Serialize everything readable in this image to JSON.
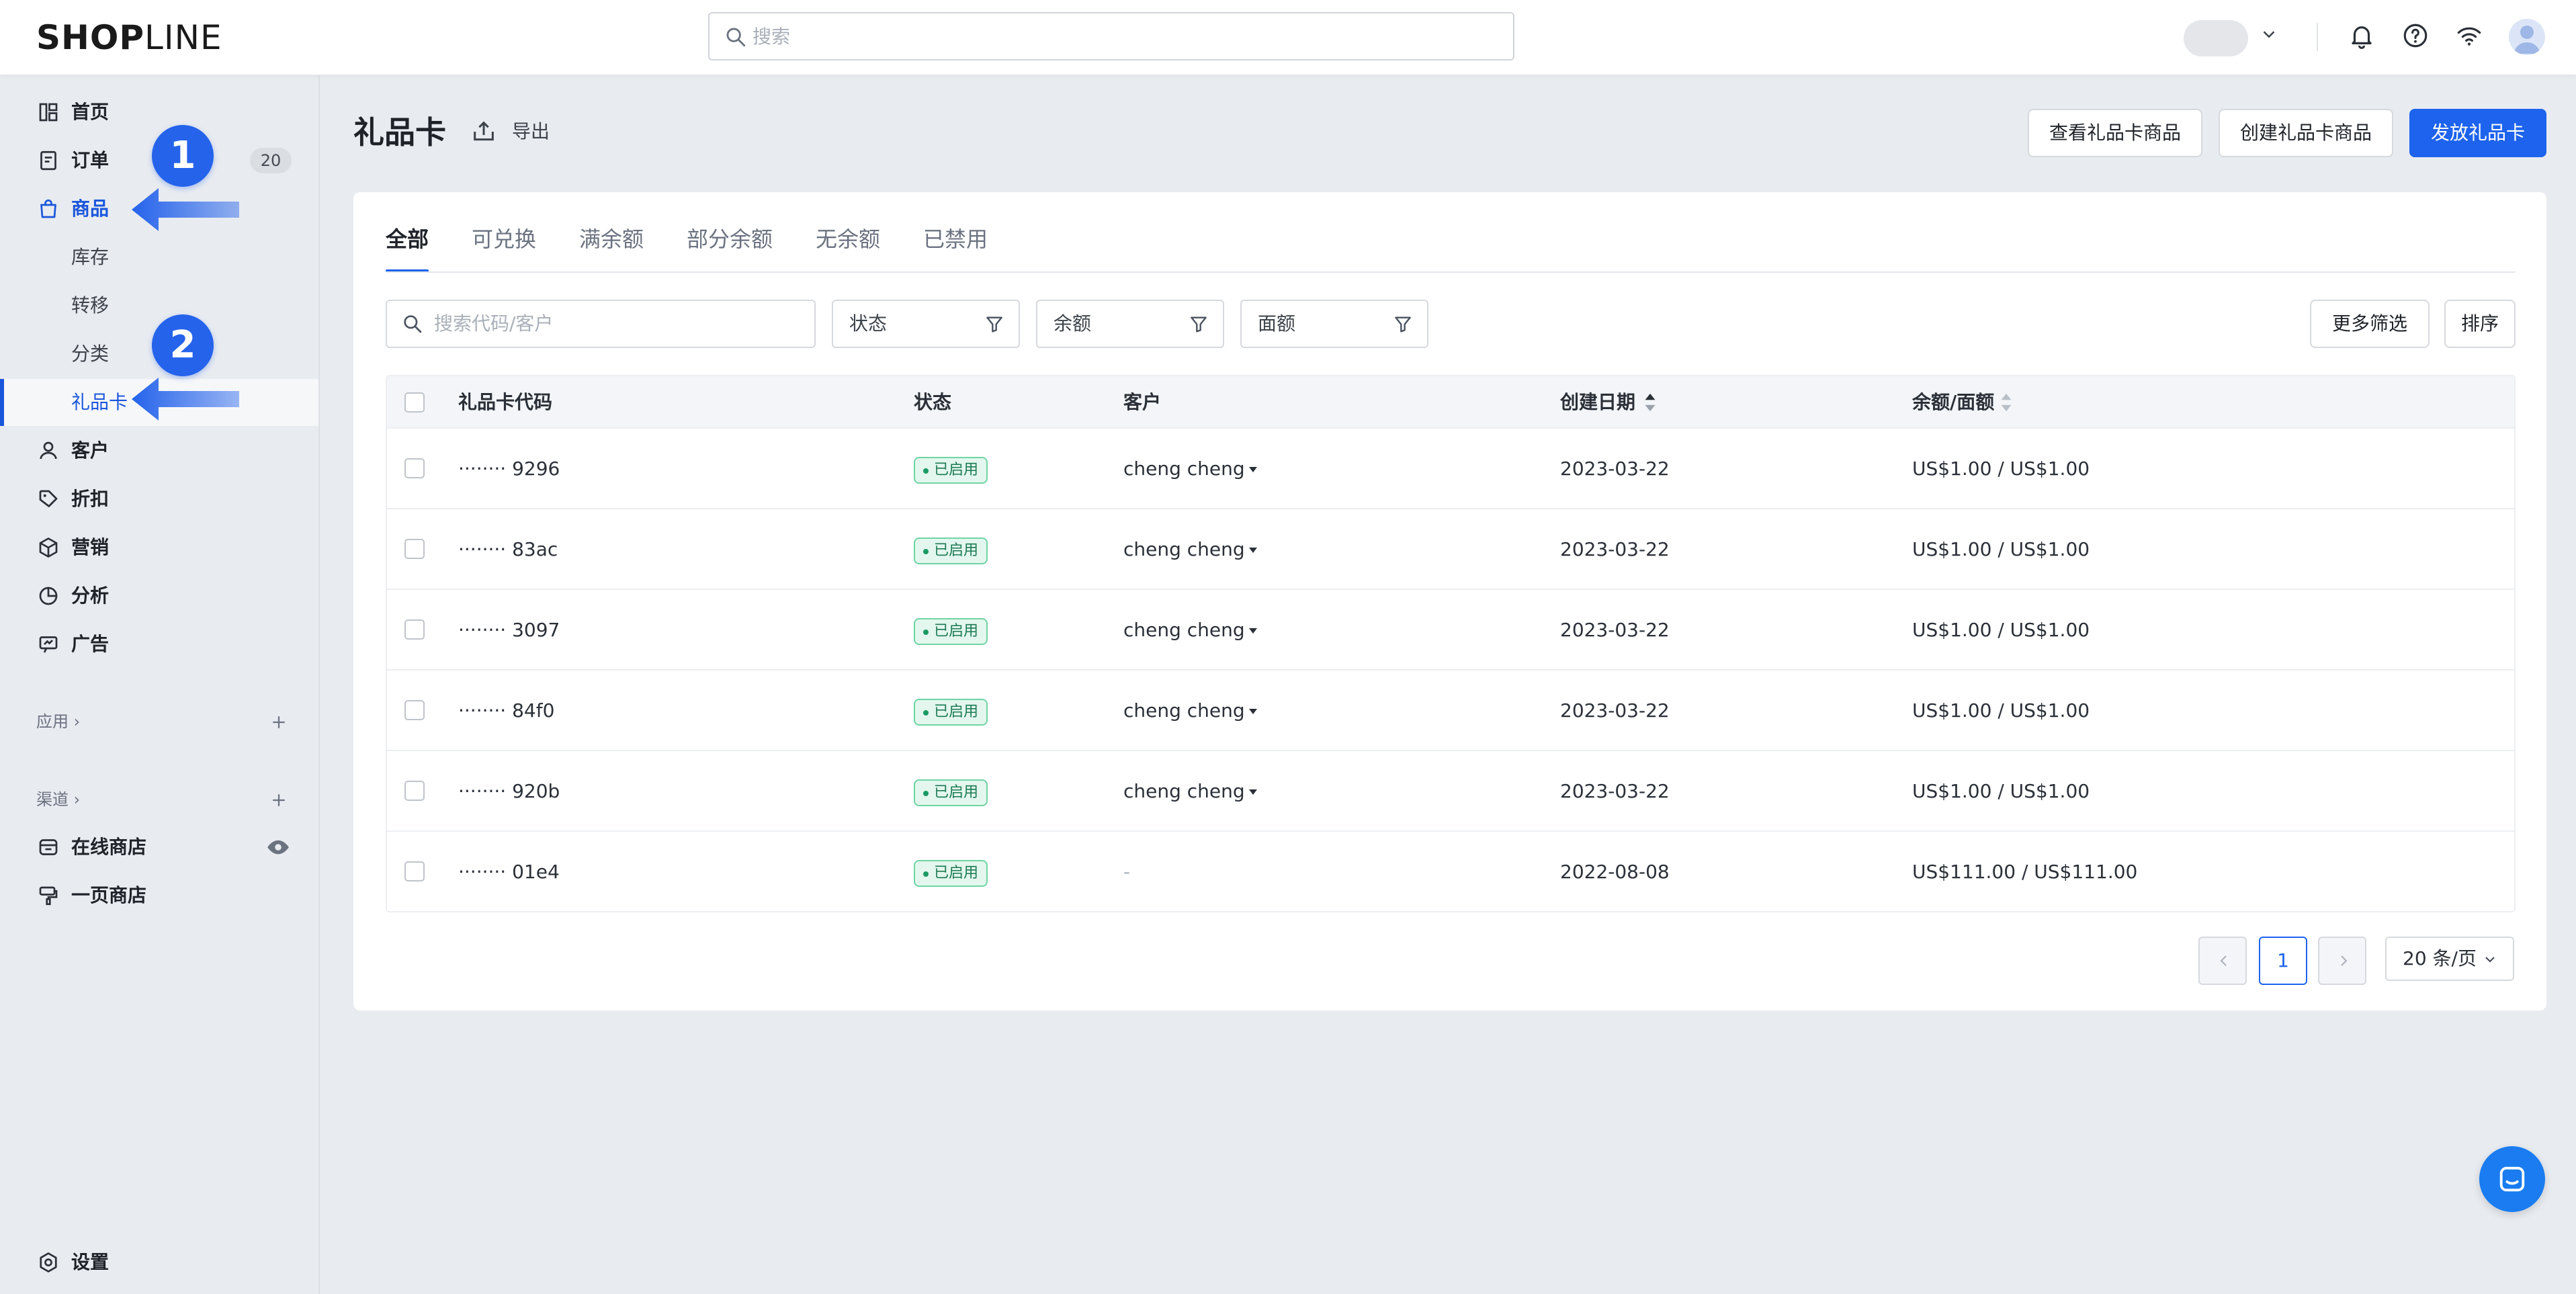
{
  "app": {
    "logo_bold": "SHOP",
    "logo_thin": "LINE"
  },
  "topbar": {
    "search_placeholder": "搜索"
  },
  "sidebar": {
    "items": [
      {
        "label": "首页",
        "icon": "dashboard-icon"
      },
      {
        "label": "订单",
        "icon": "order-icon",
        "badge": "20"
      },
      {
        "label": "商品",
        "icon": "bag-icon",
        "active": true
      },
      {
        "label": "客户",
        "icon": "user-icon"
      },
      {
        "label": "折扣",
        "icon": "tag-icon"
      },
      {
        "label": "营销",
        "icon": "cube-icon"
      },
      {
        "label": "分析",
        "icon": "pie-icon"
      },
      {
        "label": "广告",
        "icon": "ad-icon"
      }
    ],
    "product_sub": [
      "库存",
      "转移",
      "分类",
      "礼品卡"
    ],
    "apps_label": "应用",
    "channels_label": "渠道",
    "channels": [
      "在线商店",
      "一页商店"
    ],
    "settings_label": "设置",
    "callouts": [
      "1",
      "2"
    ]
  },
  "header": {
    "title": "礼品卡",
    "export_label": "导出",
    "buttons": [
      "查看礼品卡商品",
      "创建礼品卡商品",
      "发放礼品卡"
    ]
  },
  "tabs": [
    "全部",
    "可兑换",
    "满余额",
    "部分余额",
    "无余额",
    "已禁用"
  ],
  "filters": {
    "search_placeholder": "搜索代码/客户",
    "status": "状态",
    "balance": "余额",
    "face_value": "面额",
    "more": "更多筛选",
    "sort": "排序"
  },
  "table": {
    "headers": [
      "礼品卡代码",
      "状态",
      "客户",
      "创建日期",
      "余额/面额"
    ],
    "rows": [
      {
        "code": "········ 9296",
        "status": "已启用",
        "customer": "cheng cheng",
        "date": "2023-03-22",
        "balance": "US$1.00 / US$1.00"
      },
      {
        "code": "········ 83ac",
        "status": "已启用",
        "customer": "cheng cheng",
        "date": "2023-03-22",
        "balance": "US$1.00 / US$1.00"
      },
      {
        "code": "········ 3097",
        "status": "已启用",
        "customer": "cheng cheng",
        "date": "2023-03-22",
        "balance": "US$1.00 / US$1.00"
      },
      {
        "code": "········ 84f0",
        "status": "已启用",
        "customer": "cheng cheng",
        "date": "2023-03-22",
        "balance": "US$1.00 / US$1.00"
      },
      {
        "code": "········ 920b",
        "status": "已启用",
        "customer": "cheng cheng",
        "date": "2023-03-22",
        "balance": "US$1.00 / US$1.00"
      },
      {
        "code": "········ 01e4",
        "status": "已启用",
        "customer": "-",
        "date": "2022-08-08",
        "balance": "US$111.00 / US$111.00"
      }
    ]
  },
  "pagination": {
    "current_page": "1",
    "page_size": "20 条/页"
  },
  "colors": {
    "primary": "#1d63ed",
    "status_green": "#1b7a52"
  }
}
